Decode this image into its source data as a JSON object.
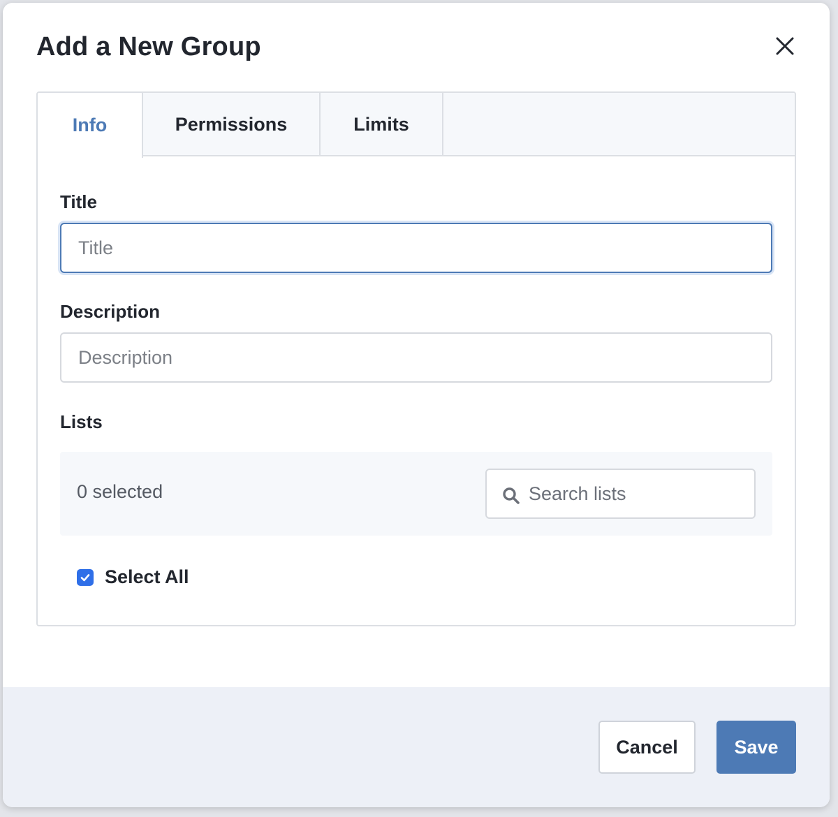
{
  "dialog": {
    "title": "Add a New Group"
  },
  "tabs": [
    {
      "label": "Info",
      "active": true
    },
    {
      "label": "Permissions",
      "active": false
    },
    {
      "label": "Limits",
      "active": false
    }
  ],
  "form": {
    "title_label": "Title",
    "title_placeholder": "Title",
    "title_value": "",
    "description_label": "Description",
    "description_placeholder": "Description",
    "description_value": "",
    "lists_label": "Lists",
    "selected_count": "0 selected",
    "search_placeholder": "Search lists",
    "select_all_label": "Select All",
    "select_all_checked": true
  },
  "footer": {
    "cancel_label": "Cancel",
    "save_label": "Save"
  },
  "colors": {
    "accent": "#4d7ab5",
    "checkbox": "#2f6fe8",
    "footer_bg": "#edf0f7"
  },
  "icons": {
    "close": "close-icon",
    "search": "search-icon",
    "check": "check-icon"
  }
}
